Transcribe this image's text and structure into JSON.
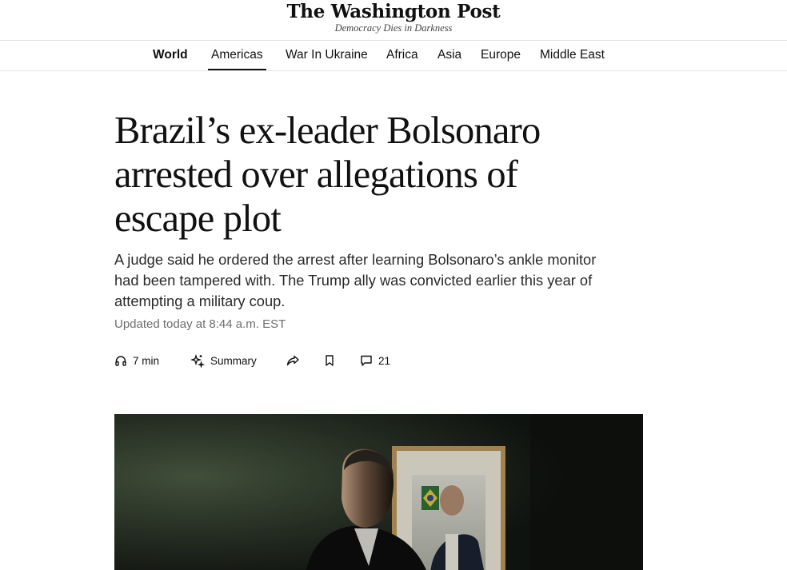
{
  "masthead": {
    "logo": "The Washington Post",
    "tagline": "Democracy Dies in Darkness"
  },
  "nav": {
    "items": [
      {
        "label": "World"
      },
      {
        "label": "Americas"
      },
      {
        "label": "War In Ukraine"
      },
      {
        "label": "Africa"
      },
      {
        "label": "Asia"
      },
      {
        "label": "Europe"
      },
      {
        "label": "Middle East"
      }
    ]
  },
  "article": {
    "headline_lines": [
      "Brazil’s ex-leader Bolsonaro",
      "arrested over allegations of",
      "escape plot"
    ],
    "deck_lines": [
      "A judge said he ordered the arrest after learning Bolsonaro’s ankle monitor",
      "had been tampered with. The Trump ally was convicted earlier this year of",
      "attempting a military coup."
    ],
    "timestamp": "Updated today at 8:44 a.m. EST"
  },
  "actions": {
    "listen": {
      "label": "7 min",
      "icon": "headphones-icon"
    },
    "summary": {
      "label": "Summary",
      "icon": "sparkle-icon"
    },
    "share": {
      "icon": "share-icon"
    },
    "save": {
      "icon": "bookmark-icon"
    },
    "comments": {
      "label": "21",
      "icon": "comment-icon"
    }
  }
}
